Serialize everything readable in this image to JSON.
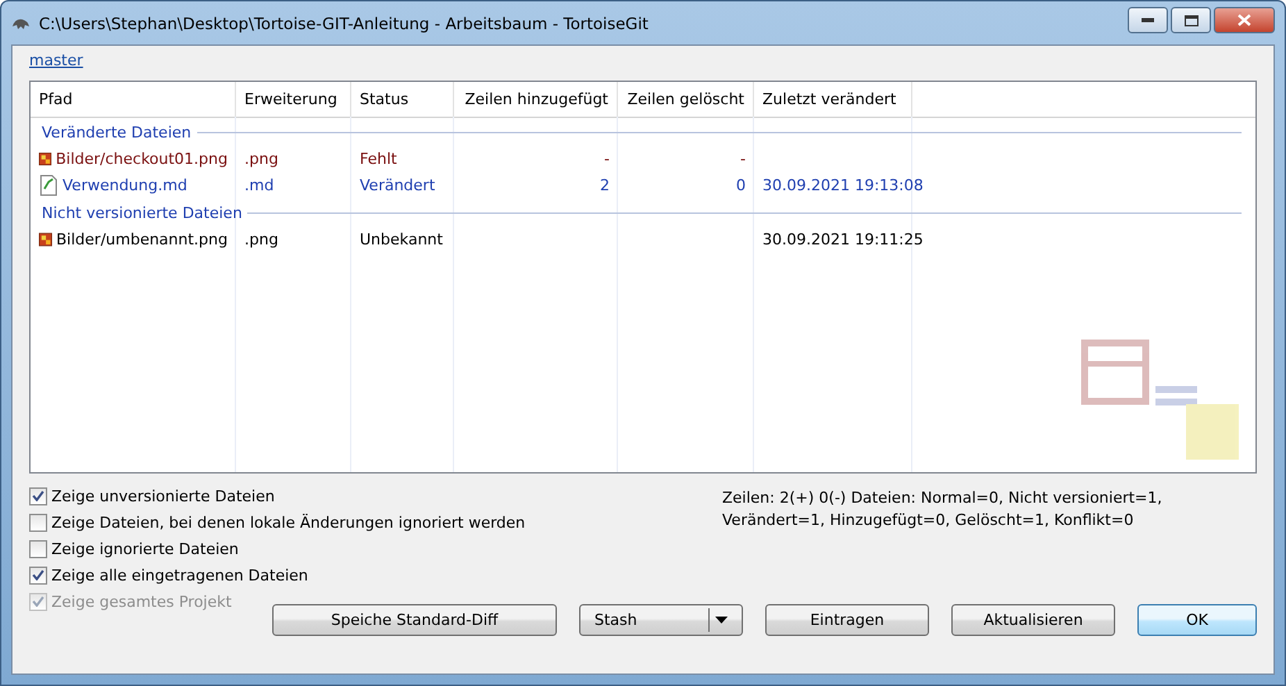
{
  "window": {
    "title": "C:\\Users\\Stephan\\Desktop\\Tortoise-GIT-Anleitung - Arbeitsbaum - TortoiseGit"
  },
  "branch_link": "master",
  "table": {
    "columns": [
      "Pfad",
      "Erweiterung",
      "Status",
      "Zeilen hinzugefügt",
      "Zeilen gelöscht",
      "Zuletzt verändert"
    ],
    "groups": [
      {
        "title": "Veränderte Dateien",
        "rows": [
          {
            "kind": "missing",
            "cells": [
              "Bilder/checkout01.png",
              ".png",
              "Fehlt",
              "-",
              "-",
              ""
            ]
          },
          {
            "kind": "modified",
            "cells": [
              "Verwendung.md",
              ".md",
              "Verändert",
              "2",
              "0",
              "30.09.2021 19:13:08"
            ]
          }
        ]
      },
      {
        "title": "Nicht versionierte Dateien",
        "rows": [
          {
            "kind": "unversioned",
            "cells": [
              "Bilder/umbenannt.png",
              ".png",
              "Unbekannt",
              "",
              "",
              "30.09.2021 19:11:25"
            ]
          }
        ]
      }
    ]
  },
  "options": [
    {
      "label": "Zeige unversionierte Dateien",
      "checked": true,
      "disabled": false
    },
    {
      "label": "Zeige Dateien, bei denen lokale Änderungen ignoriert werden",
      "checked": false,
      "disabled": false
    },
    {
      "label": "Zeige ignorierte Dateien",
      "checked": false,
      "disabled": false
    },
    {
      "label": "Zeige alle eingetragenen Dateien",
      "checked": true,
      "disabled": false
    },
    {
      "label": "Zeige gesamtes Projekt",
      "checked": true,
      "disabled": true
    }
  ],
  "summary": "Zeilen: 2(+) 0(-) Dateien: Normal=0, Nicht versioniert=1, Verändert=1, Hinzugefügt=0, Gelöscht=1, Konflikt=0",
  "buttons": [
    {
      "label": "Speiche Standard-Diff",
      "kind": "normal"
    },
    {
      "label": "Stash",
      "kind": "split"
    },
    {
      "label": "Eintragen",
      "kind": "normal"
    },
    {
      "label": "Aktualisieren",
      "kind": "normal"
    },
    {
      "label": "OK",
      "kind": "default"
    }
  ]
}
